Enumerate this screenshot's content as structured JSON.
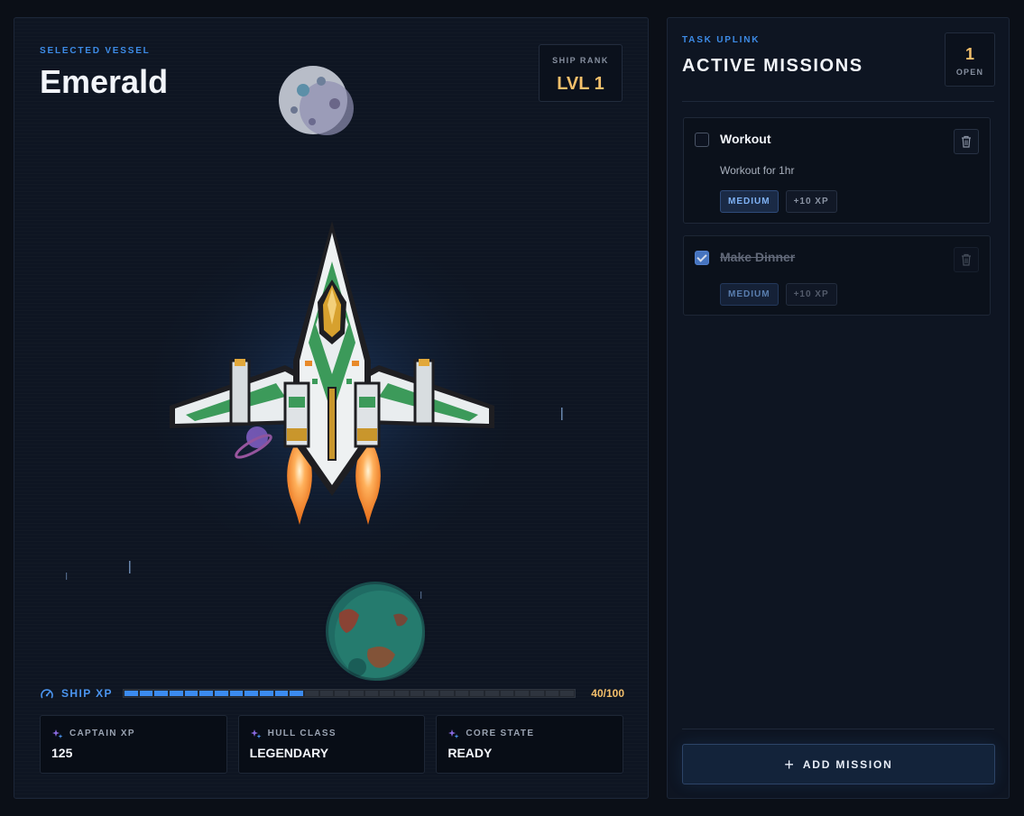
{
  "vessel": {
    "eyebrow": "SELECTED VESSEL",
    "name": "Emerald",
    "rank_label": "SHIP RANK",
    "rank_value": "LVL 1",
    "xp_label": "SHIP XP",
    "xp_value": "40/100",
    "xp_progress": 0.4,
    "stats": [
      {
        "label": "CAPTAIN XP",
        "value": "125",
        "icon": "sparkle-icon"
      },
      {
        "label": "HULL CLASS",
        "value": "LEGENDARY",
        "icon": "sparkle-icon"
      },
      {
        "label": "CORE STATE",
        "value": "READY",
        "icon": "sparkle-icon"
      }
    ]
  },
  "missions": {
    "eyebrow": "TASK UPLINK",
    "title": "ACTIVE MISSIONS",
    "open_count": "1",
    "open_label": "OPEN",
    "items": [
      {
        "title": "Workout",
        "description": "Workout for 1hr",
        "difficulty": "MEDIUM",
        "xp": "+10 XP",
        "completed": false
      },
      {
        "title": "Make Dinner",
        "description": "",
        "difficulty": "MEDIUM",
        "xp": "+10 XP",
        "completed": true
      }
    ],
    "add_label": "ADD MISSION",
    "add_icon": "plus-icon"
  },
  "colors": {
    "accent_blue": "#3b8bf0",
    "gold": "#f4c06b",
    "panel": "#0e1522",
    "background": "#0b0f17"
  }
}
